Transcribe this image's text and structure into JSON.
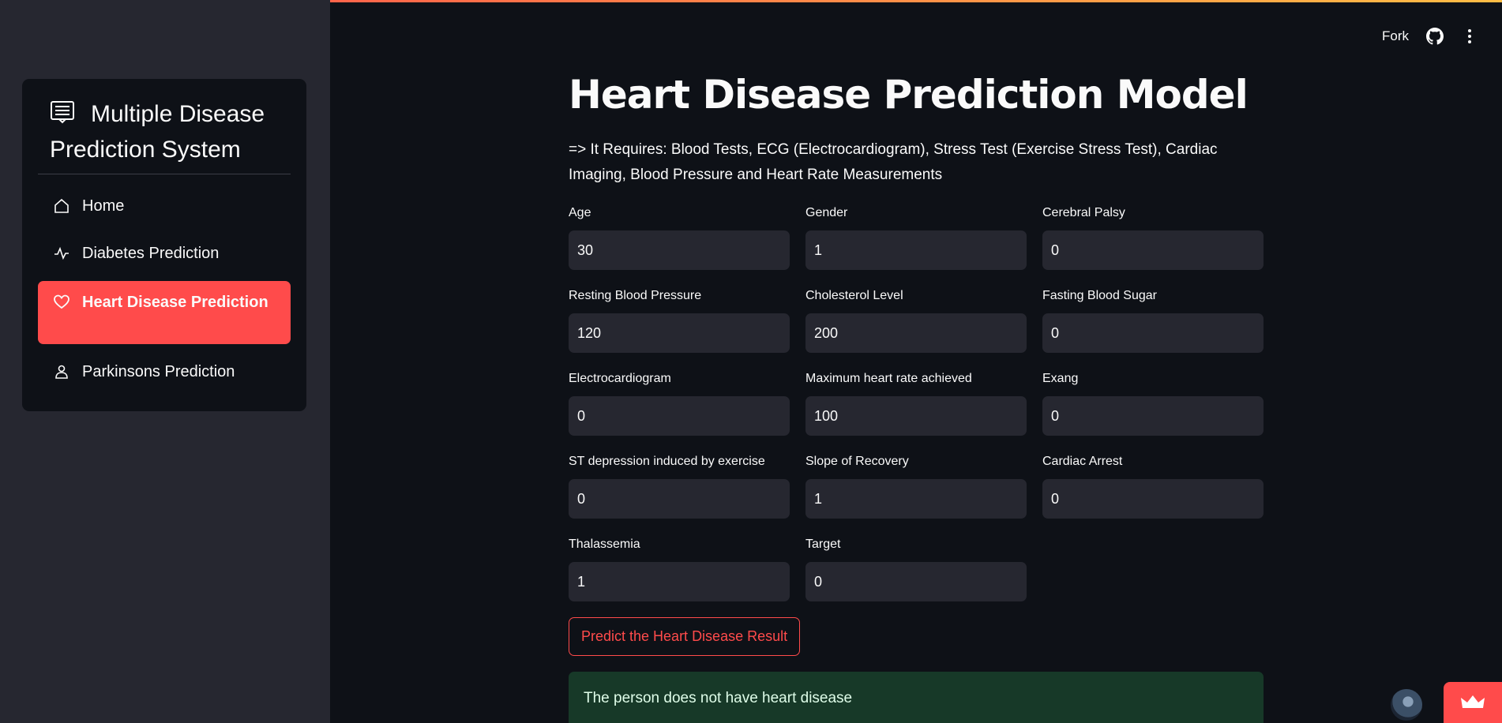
{
  "app": {
    "accent_color": "#ff4b4b",
    "background_color": "#0e1117",
    "sidebar_color": "#262730"
  },
  "sidebar": {
    "title": "Multiple Disease Prediction System",
    "title_icon": "document-list-icon",
    "items": [
      {
        "label": "Home",
        "icon": "house-icon",
        "active": false
      },
      {
        "label": "Diabetes Prediction",
        "icon": "activity-icon",
        "active": false
      },
      {
        "label": "Heart Disease Prediction",
        "icon": "heart-icon",
        "active": true
      },
      {
        "label": "Parkinsons Prediction",
        "icon": "person-icon",
        "active": false
      }
    ]
  },
  "toolbar": {
    "fork_label": "Fork",
    "github_icon": "github-icon",
    "menu_icon": "kebab-menu-icon"
  },
  "main": {
    "title": "Heart Disease Prediction Model",
    "requirements": "=> It Requires: Blood Tests, ECG (Electrocardiogram), Stress Test (Exercise Stress Test), Cardiac Imaging, Blood Pressure and Heart Rate Measurements",
    "fields": [
      {
        "label": "Age",
        "value": "30"
      },
      {
        "label": "Gender",
        "value": "1"
      },
      {
        "label": "Cerebral Palsy",
        "value": "0"
      },
      {
        "label": "Resting Blood Pressure",
        "value": "120"
      },
      {
        "label": "Cholesterol Level",
        "value": "200"
      },
      {
        "label": "Fasting Blood Sugar",
        "value": "0"
      },
      {
        "label": "Electrocardiogram",
        "value": "0"
      },
      {
        "label": "Maximum heart rate achieved",
        "value": "100"
      },
      {
        "label": "Exang",
        "value": "0"
      },
      {
        "label": "ST depression induced by exercise",
        "value": "0"
      },
      {
        "label": "Slope of Recovery",
        "value": "1"
      },
      {
        "label": "Cardiac Arrest",
        "value": "0"
      },
      {
        "label": "Thalassemia",
        "value": "1"
      },
      {
        "label": "Target",
        "value": "0"
      }
    ],
    "predict_button": "Predict the Heart Disease Result",
    "result": "The person does not have heart disease",
    "result_color": "#173928"
  },
  "footer": {
    "avatar_icon": "user-avatar",
    "badge_icon": "crown-icon"
  }
}
